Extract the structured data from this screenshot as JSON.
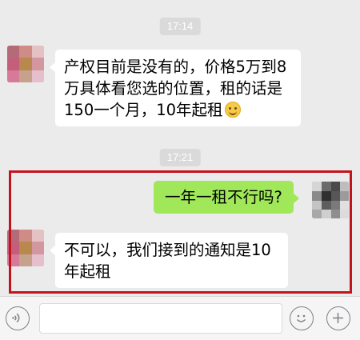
{
  "chat": {
    "messages": [
      {
        "type": "time",
        "text": "17:14"
      },
      {
        "type": "received",
        "text": "产权目前是没有的，价格5万到8万具体看您选的位置，租的话是150一个月，10年起租",
        "emoji": "smiling-face"
      },
      {
        "type": "time",
        "text": "17:21"
      },
      {
        "type": "sent",
        "text": "一年一租不行吗?"
      },
      {
        "type": "received",
        "text": "不可以，我们接到的通知是10年起租"
      }
    ]
  },
  "colors": {
    "background": "#ebebeb",
    "sent_bubble": "#a0e75a",
    "received_bubble": "#ffffff",
    "highlight_border": "#c3131d"
  },
  "input_bar": {
    "value": "",
    "icons": [
      "voice-icon",
      "emoji-icon",
      "plus-icon"
    ]
  }
}
